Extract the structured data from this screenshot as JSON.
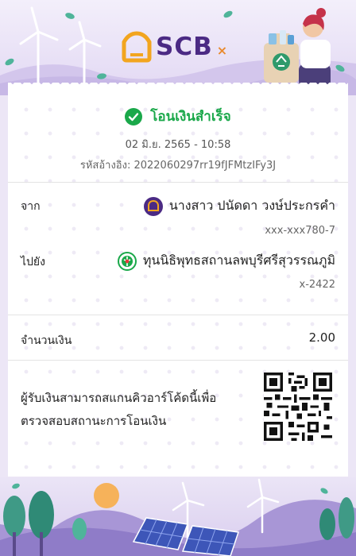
{
  "brand": {
    "name": "SCB",
    "partner_mark": "×"
  },
  "status": {
    "title": "โอนเงินสำเร็จ"
  },
  "transaction": {
    "datetime": "02 มิ.ย. 2565 - 10:58",
    "reference": "รหัสอ้างอิง: 2022060297rr19fJFMtzIFy3J"
  },
  "from": {
    "label": "จาก",
    "name": "นางสาว ปนัดดา วงษ์ประกรคำ",
    "account": "xxx-xxx780-7",
    "bank_color": "#4b2a84"
  },
  "to": {
    "label": "ไปยัง",
    "name": "ทุนนิธิพุทธสถานลพบุรีศรีสุวรรณภูมิ",
    "account": "x-2422",
    "bank_color": "#1aa84a"
  },
  "amount": {
    "label": "จำนวนเงิน",
    "value": "2.00"
  },
  "qr_note": {
    "text": "ผู้รับเงินสามารถสแกนคิวอาร์โค้ดนี้เพื่อตรวจสอบสถานะการโอนเงิน"
  },
  "colors": {
    "success": "#1aa84a",
    "brand_purple": "#4b2a84",
    "brand_gold": "#f2a51f"
  },
  "icons": {
    "success": "check-circle-icon",
    "from_bank": "scb-bank-icon",
    "to_bank": "kbank-bank-icon",
    "qr": "qr-code-icon"
  }
}
